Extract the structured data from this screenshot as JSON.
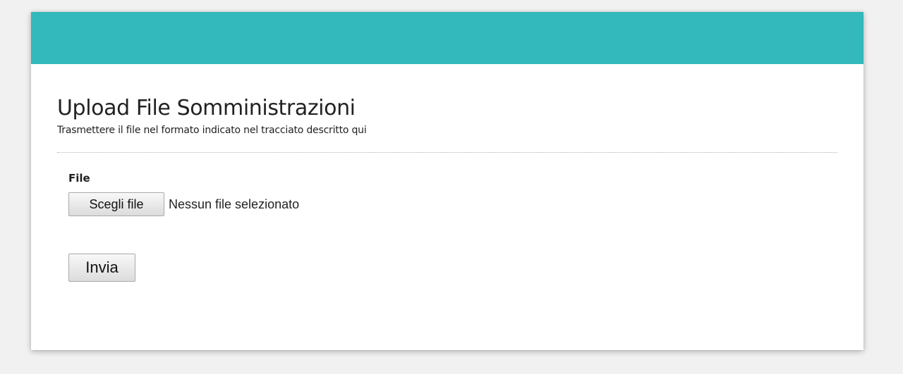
{
  "page": {
    "title": "Upload File Somministrazioni",
    "subtitle": "Trasmettere il file nel formato indicato nel tracciato descritto qui"
  },
  "form": {
    "file_label": "File",
    "choose_button_label": "Scegli file",
    "file_status": "Nessun file selezionato",
    "submit_label": "Invia"
  },
  "colors": {
    "header_bar": "#33b8bc",
    "page_background": "#f1f1f1",
    "card_background": "#ffffff"
  }
}
